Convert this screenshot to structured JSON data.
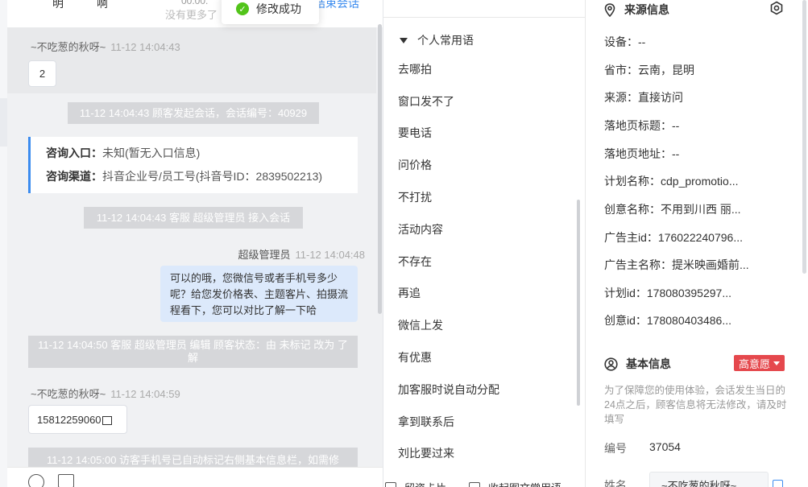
{
  "chat": {
    "header": {
      "name_1": "明",
      "name_2": "啊",
      "time": "00:00:",
      "more": "没有更多了",
      "end_button": "结束会话"
    },
    "toast": "修改成功",
    "messages": {
      "m1_sender": "~不吃葱的秋呀~",
      "m1_time": "11-12 14:04:43",
      "m1_text": "2",
      "sys1": "11-12 14:04:43 顾客发起会话，会话编号：40929",
      "entry_label": "咨询入口：",
      "entry_value": "未知(暂无入口信息)",
      "channel_label": "咨询渠道：",
      "channel_value": "抖音企业号/员工号(抖音号ID：2839502213)",
      "sys2": "11-12 14:04:43 客服 超级管理员 接入会话",
      "out_sender": "超级管理员",
      "out_time": "11-12 14:04:48",
      "out_text": "可以的哦，您微信号或者手机号多少呢？给您发价格表、主题客片、拍摄流程看下，您可以对比了解一下哈",
      "sys3": "11-12 14:04:50 客服 超级管理员 编辑 顾客状态：由 未标记 改为 了解",
      "m2_sender": "~不吃葱的秋呀~",
      "m2_time": "11-12 14:04:59",
      "m2_text": "15812259060",
      "sys4": "11-12 14:05:00 访客手机号已自动标记右侧基本信息栏，如需修"
    }
  },
  "phrases": {
    "group_title": "个人常用语",
    "items": [
      "去哪拍",
      "窗口发不了",
      "要电话",
      "问价格",
      "不打扰",
      "活动内容",
      "不存在",
      "再追",
      "微信上发",
      "有优惠",
      "加客服时说自动分配",
      "拿到联系后",
      "刘比要过来"
    ],
    "footer_left": "留资卡片",
    "footer_right": "收起图文常用语"
  },
  "side": {
    "source_title": "来源信息",
    "source_rows": [
      "设备：--",
      "省市：云南，昆明",
      "来源：直接访问",
      "落地页标题：--",
      "落地页地址：--",
      "计划名称：cdp_promotio...",
      "创意名称：不用到川西 丽...",
      "广告主id：176022240796...",
      "广告主名称：提米映画婚前...",
      "计划id：178080395297...",
      "创意id：178080403486..."
    ],
    "basic_title": "基本信息",
    "intent_badge": "高意愿",
    "hint": "为了保障您的使用体验，会话发生当日的24点之后，顾客信息将无法修改，请及时填写",
    "id_label": "编号",
    "id_value": "37054",
    "name_label": "姓名",
    "name_value": "~不吃葱的秋呀~"
  },
  "colors": {
    "accent": "#3c8cef",
    "success": "#52c41a",
    "badge": "#e5484d",
    "out_bubble": "#dce9fb"
  },
  "icons": [
    "check-circle-icon",
    "location-pin-icon",
    "settings-icon",
    "user-circle-icon",
    "emoji-icon",
    "image-icon",
    "copy-icon",
    "card-icon",
    "edit-icon"
  ]
}
